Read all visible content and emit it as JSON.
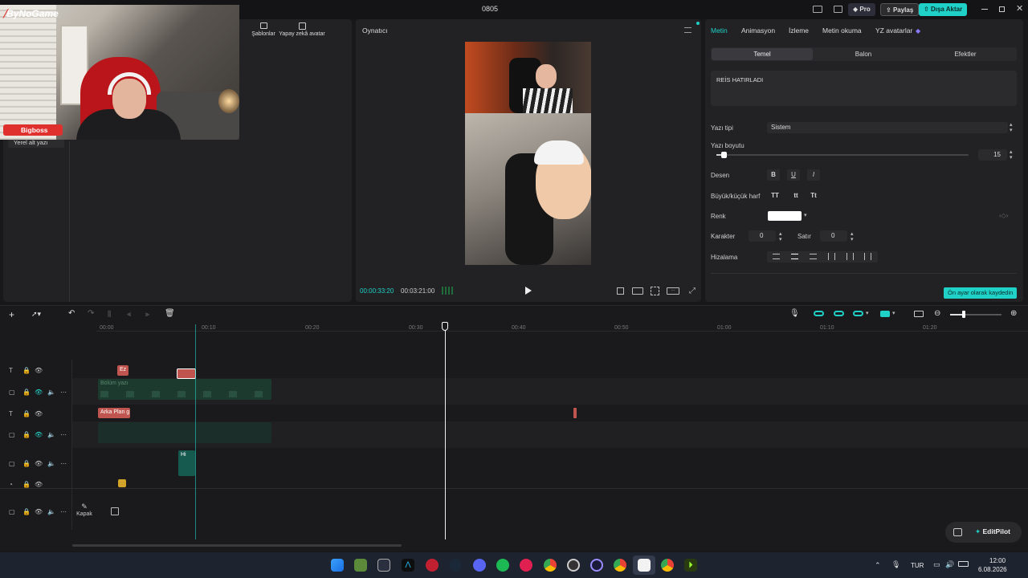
{
  "window": {
    "title": "0805",
    "pro_label": "Pro",
    "share_label": "Paylaş",
    "export_label": "Dışa Aktar"
  },
  "webcam": {
    "brand": "ByNoGame",
    "user_badge": "Bigboss"
  },
  "media_panel": {
    "tabs": [
      {
        "label": "Şablonlar",
        "icon": "template-icon"
      },
      {
        "label": "Yapay zekâ avatar",
        "icon": "avatar-icon"
      }
    ],
    "list_item": "Yerel alt yazı"
  },
  "player": {
    "title": "Oynatıcı",
    "current_time": "00:00:33:20",
    "total_time": "00:03:21:00",
    "ratio_label": "Oran"
  },
  "text_panel": {
    "tabs": [
      "Metin",
      "Animasyon",
      "İzleme",
      "Metin okuma",
      "YZ avatarlar"
    ],
    "subtabs": [
      "Temel",
      "Balon",
      "Efektler"
    ],
    "text_value": "REİS HATIRLADI",
    "font_label": "Yazı tipi",
    "font_value": "Sistem",
    "size_label": "Yazı boyutu",
    "size_value": "15",
    "size_fraction": 0.1,
    "pattern_label": "Desen",
    "pattern_buttons": [
      "B",
      "U",
      "I"
    ],
    "case_label": "Büyük/küçük harf",
    "case_buttons": [
      "TT",
      "tt",
      "Tt"
    ],
    "color_label": "Renk",
    "color_value": "#ffffff",
    "char_label": "Karakter",
    "char_value": "0",
    "line_label": "Satır",
    "line_value": "0",
    "align_label": "Hizalama",
    "save_default_label": "Ön ayar olarak kaydedin"
  },
  "timeline": {
    "ruler": [
      "00:00",
      "00:10",
      "00:20",
      "00:30",
      "00:40",
      "00:50",
      "01:00",
      "01:10",
      "01:20"
    ],
    "clips": {
      "text1": "Ez",
      "text2": "Arka Plan g",
      "video_track_label": "Bölüm yazı",
      "sticker": "Hi"
    },
    "cover_label": "Kapak",
    "editpilot_label": "EditPilot"
  },
  "taskbar": {
    "lang": "TUR",
    "time": "12:00",
    "date": "6.08.2026"
  },
  "colors": {
    "accent": "#1fd1c6",
    "bg": "#18181a",
    "panel": "#222225",
    "badge_red": "#e0302e"
  }
}
